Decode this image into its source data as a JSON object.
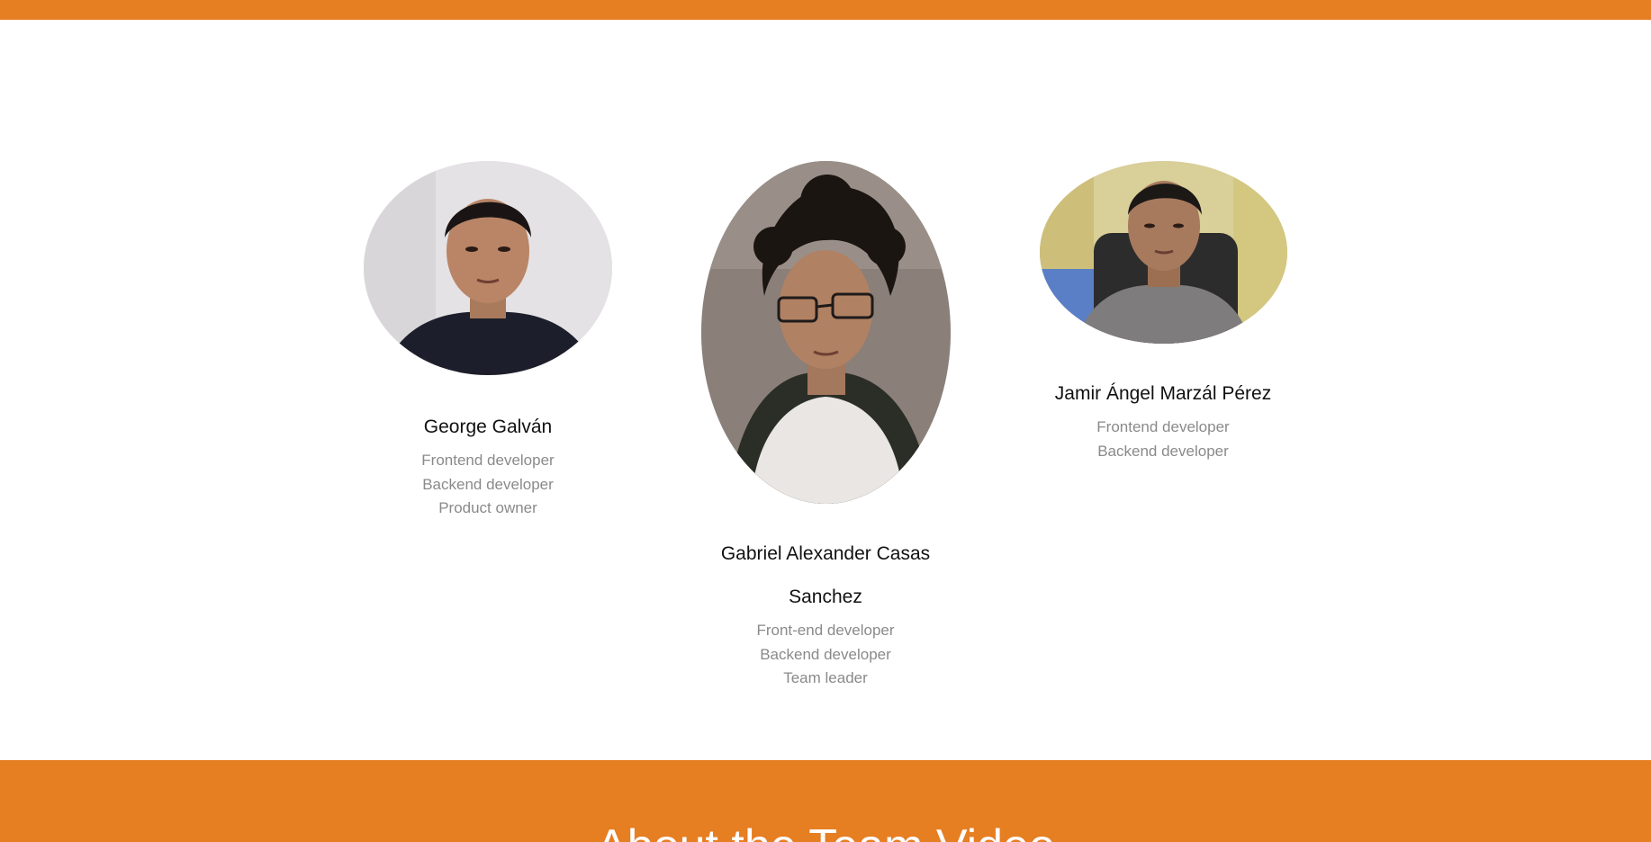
{
  "colors": {
    "accent": "#e67e22",
    "name_text": "#111111",
    "role_text": "#8a8a8a",
    "background": "#ffffff"
  },
  "team": {
    "members": [
      {
        "name": "George Galván",
        "roles": [
          "Frontend developer",
          "Backend developer",
          "Product owner"
        ]
      },
      {
        "name": "Gabriel Alexander Casas Sanchez",
        "roles": [
          "Front-end developer",
          "Backend developer",
          "Team leader"
        ]
      },
      {
        "name": "Jamir Ángel Marzál Pérez",
        "roles": [
          "Frontend developer",
          "Backend developer"
        ]
      }
    ]
  },
  "bottom_section": {
    "title": "About the Team Video"
  }
}
